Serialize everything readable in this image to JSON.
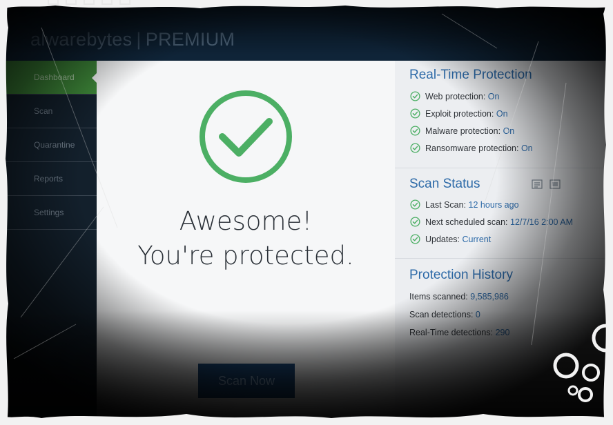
{
  "app": {
    "brand_name": "alwarebytes",
    "brand_separator": "|",
    "brand_tier": "PREMIUM"
  },
  "sidebar": {
    "items": [
      {
        "label": "Dashboard"
      },
      {
        "label": "Scan"
      },
      {
        "label": "Quarantine"
      },
      {
        "label": "Reports"
      },
      {
        "label": "Settings"
      }
    ]
  },
  "main": {
    "headline_line1": "Awesome!",
    "headline_line2": "You're protected.",
    "scan_button_label": "Scan Now",
    "status_color": "#4caf64"
  },
  "realtime": {
    "title": "Real-Time Protection",
    "items": [
      {
        "label": "Web protection: ",
        "value": "On"
      },
      {
        "label": "Exploit protection: ",
        "value": "On"
      },
      {
        "label": "Malware protection: ",
        "value": "On"
      },
      {
        "label": "Ransomware protection: ",
        "value": "On"
      }
    ]
  },
  "scan_status": {
    "title": "Scan Status",
    "items": [
      {
        "label": "Last Scan: ",
        "value": "12 hours ago"
      },
      {
        "label": "Next scheduled scan: ",
        "value": "12/7/16 2:00 AM"
      },
      {
        "label": "Updates: ",
        "value": "Current"
      }
    ]
  },
  "history": {
    "title": "Protection History",
    "items": [
      {
        "label": "Items scanned: ",
        "value": "9,585,986"
      },
      {
        "label": "Scan detections: ",
        "value": "0"
      },
      {
        "label": "Real-Time detections: ",
        "value": "290"
      }
    ]
  }
}
